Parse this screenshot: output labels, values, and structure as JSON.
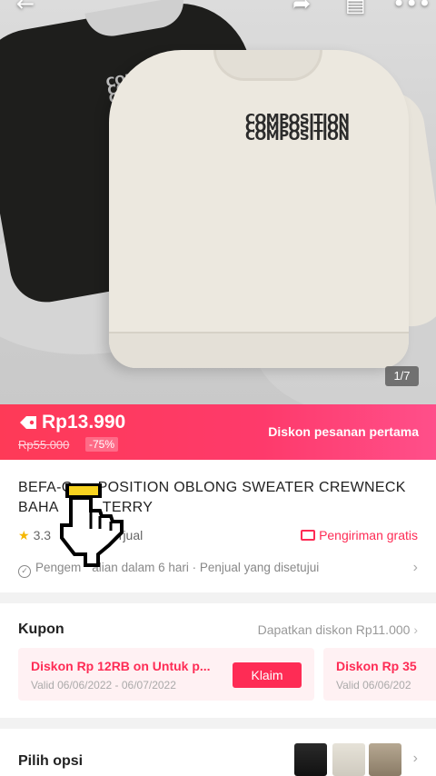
{
  "hero": {
    "image_counter": "1/7",
    "print_text": "COMPOSITION",
    "icons": [
      "back-arrow-icon",
      "share-icon",
      "cart-icon",
      "more-icon"
    ]
  },
  "price_bar": {
    "price": "Rp13.990",
    "original_price": "Rp55.000",
    "discount": "-75%",
    "promo": "Diskon pesanan pertama"
  },
  "product": {
    "title_part1": "BEFA-C",
    "title_part2": "POSITION OBLONG SWEATER CREWNECK",
    "title_line2a": "BAHA",
    "title_line2b": "TERRY",
    "rating": "3.3",
    "sold_suffix": "erjual",
    "shipping": "Pengiriman gratis",
    "return_a": "Pengem",
    "return_b": "alian dalam 6 hari · Penjual yang disetujui"
  },
  "coupons": {
    "title": "Kupon",
    "link": "Dapatkan diskon Rp11.000",
    "items": [
      {
        "title": "Diskon Rp 12RB on Untuk p...",
        "valid": "Valid 06/06/2022 - 06/07/2022",
        "button": "Klaim"
      },
      {
        "title": "Diskon Rp 35",
        "valid": "Valid 06/06/202"
      }
    ]
  },
  "options": {
    "title": "Pilih opsi"
  },
  "colors": {
    "accent": "#fe2c55",
    "price_gradient_start": "#fe3a57",
    "price_gradient_end": "#ff4f8a"
  }
}
